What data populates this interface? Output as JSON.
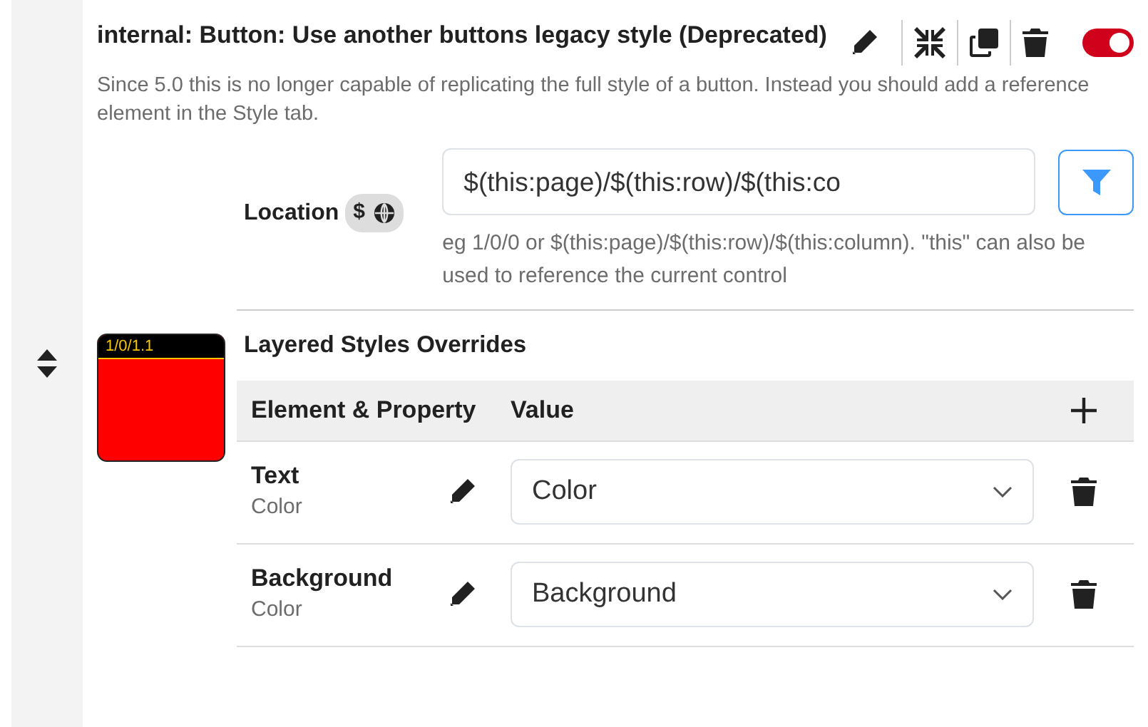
{
  "control": {
    "title": "internal: Button: Use another buttons legacy style (Deprecated)",
    "enabled": true,
    "description": "Since 5.0 this is no longer capable of replicating the full style of a button. Instead you should add a reference element in the Style tab."
  },
  "preview": {
    "label": "1/0/1.1"
  },
  "location": {
    "label": "Location",
    "badge_dollar": "$",
    "value": "$(this:page)/$(this:row)/$(this:co",
    "help": "eg 1/0/0 or $(this:page)/$(this:row)/$(this:column). \"this\" can also be used to reference the current control"
  },
  "overrides": {
    "title": "Layered Styles Overrides",
    "columns": [
      "Element & Property",
      "Value"
    ],
    "rows": [
      {
        "element": "Text",
        "property": "Color",
        "value": "Color"
      },
      {
        "element": "Background",
        "property": "Color",
        "value": "Background"
      }
    ]
  }
}
